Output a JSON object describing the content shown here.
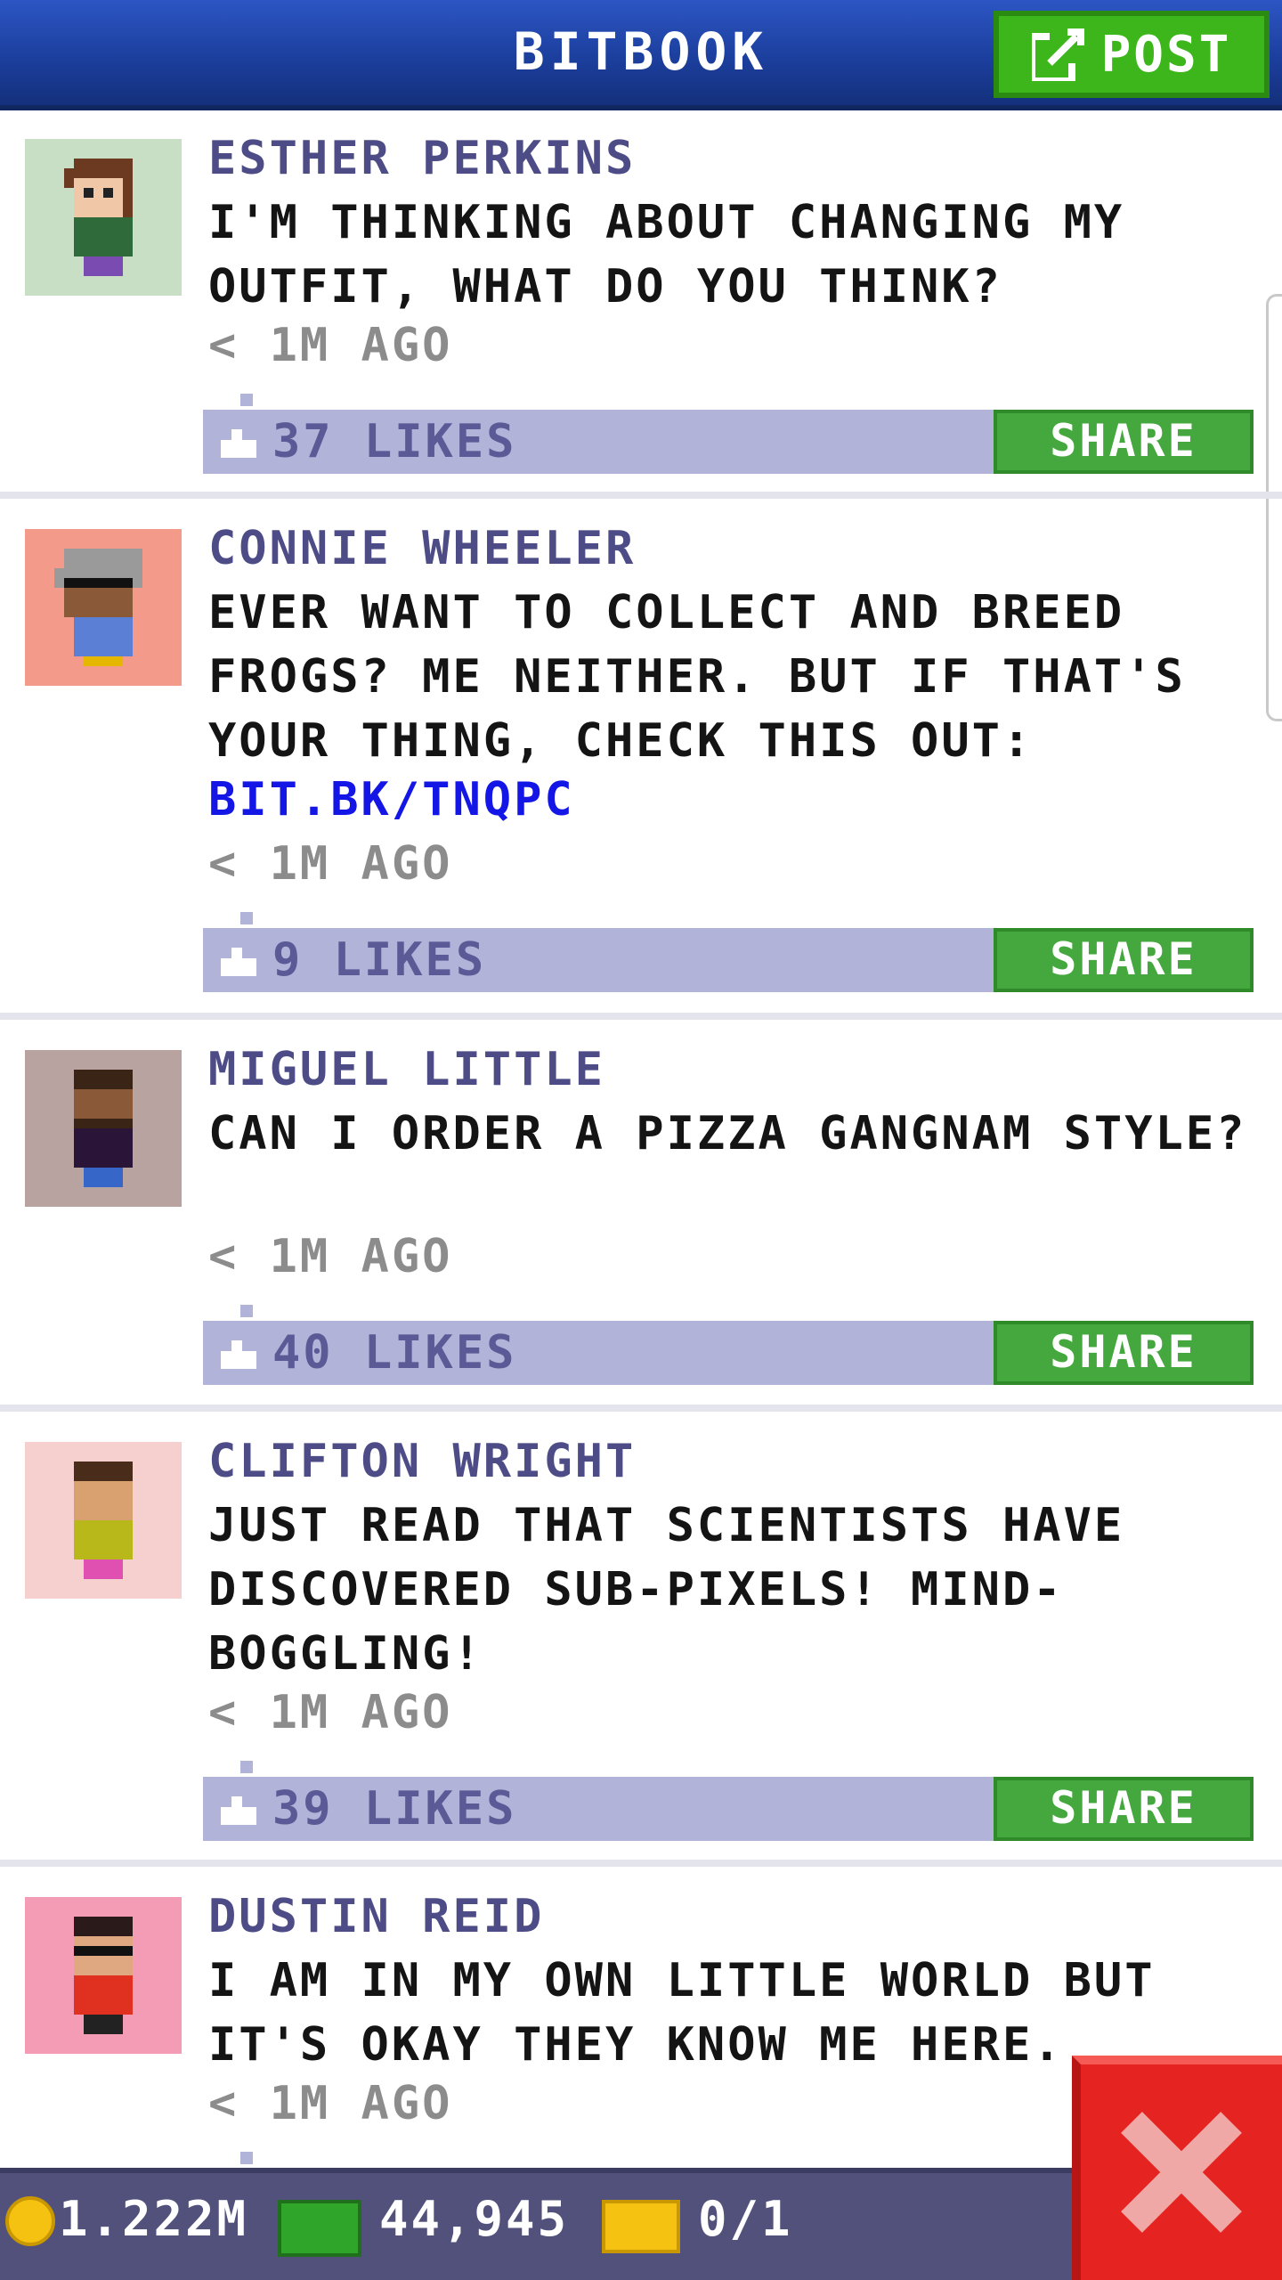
{
  "header": {
    "title": "BITBOOK",
    "post_label": "POST"
  },
  "colors": {
    "header_blue": "#1c3f9e",
    "post_green": "#3db61c",
    "likes_bar": "#b1b4d8",
    "share_green": "#45a83e",
    "link_blue": "#1416e6",
    "close_red": "#e52421"
  },
  "posts": [
    {
      "author": "ESTHER PERKINS",
      "text": "I'M THINKING ABOUT CHANGING MY OUTFIT, WHAT DO YOU THINK?",
      "link": "",
      "time": "< 1M AGO",
      "likes": "37 LIKES",
      "share": "SHARE",
      "avatar_bg": "#c8dfc6"
    },
    {
      "author": "CONNIE WHEELER",
      "text": "EVER WANT TO COLLECT AND BREED FROGS? ME NEITHER. BUT IF THAT'S YOUR THING, CHECK THIS OUT:",
      "link": "BIT.BK/TNQPC",
      "time": "< 1M AGO",
      "likes": "9 LIKES",
      "share": "SHARE",
      "avatar_bg": "#f49a8a"
    },
    {
      "author": "MIGUEL LITTLE",
      "text": "CAN I ORDER A PIZZA GANGNAM STYLE?",
      "link": "",
      "time": "< 1M AGO",
      "likes": "40 LIKES",
      "share": "SHARE",
      "avatar_bg": "#b9a3a0"
    },
    {
      "author": "CLIFTON WRIGHT",
      "text": "JUST READ THAT SCIENTISTS HAVE DISCOVERED SUB-PIXELS! MIND-BOGGLING!",
      "link": "",
      "time": "< 1M AGO",
      "likes": "39 LIKES",
      "share": "SHARE",
      "avatar_bg": "#f6d0cf"
    },
    {
      "author": "DUSTIN REID",
      "text": "I AM IN MY OWN LITTLE WORLD BUT IT'S OKAY THEY KNOW ME HERE.",
      "link": "",
      "time": "< 1M AGO",
      "likes": "",
      "share": "",
      "avatar_bg": "#f49bb6"
    }
  ],
  "status": {
    "coins": "1.222M",
    "bux": "44,945",
    "tickets": "0/1"
  },
  "icons": {
    "post": "edit-icon",
    "like": "thumbs-up-icon",
    "coin": "coin-icon",
    "bux": "bux-icon",
    "ticket": "ticket-icon",
    "close": "close-icon"
  }
}
